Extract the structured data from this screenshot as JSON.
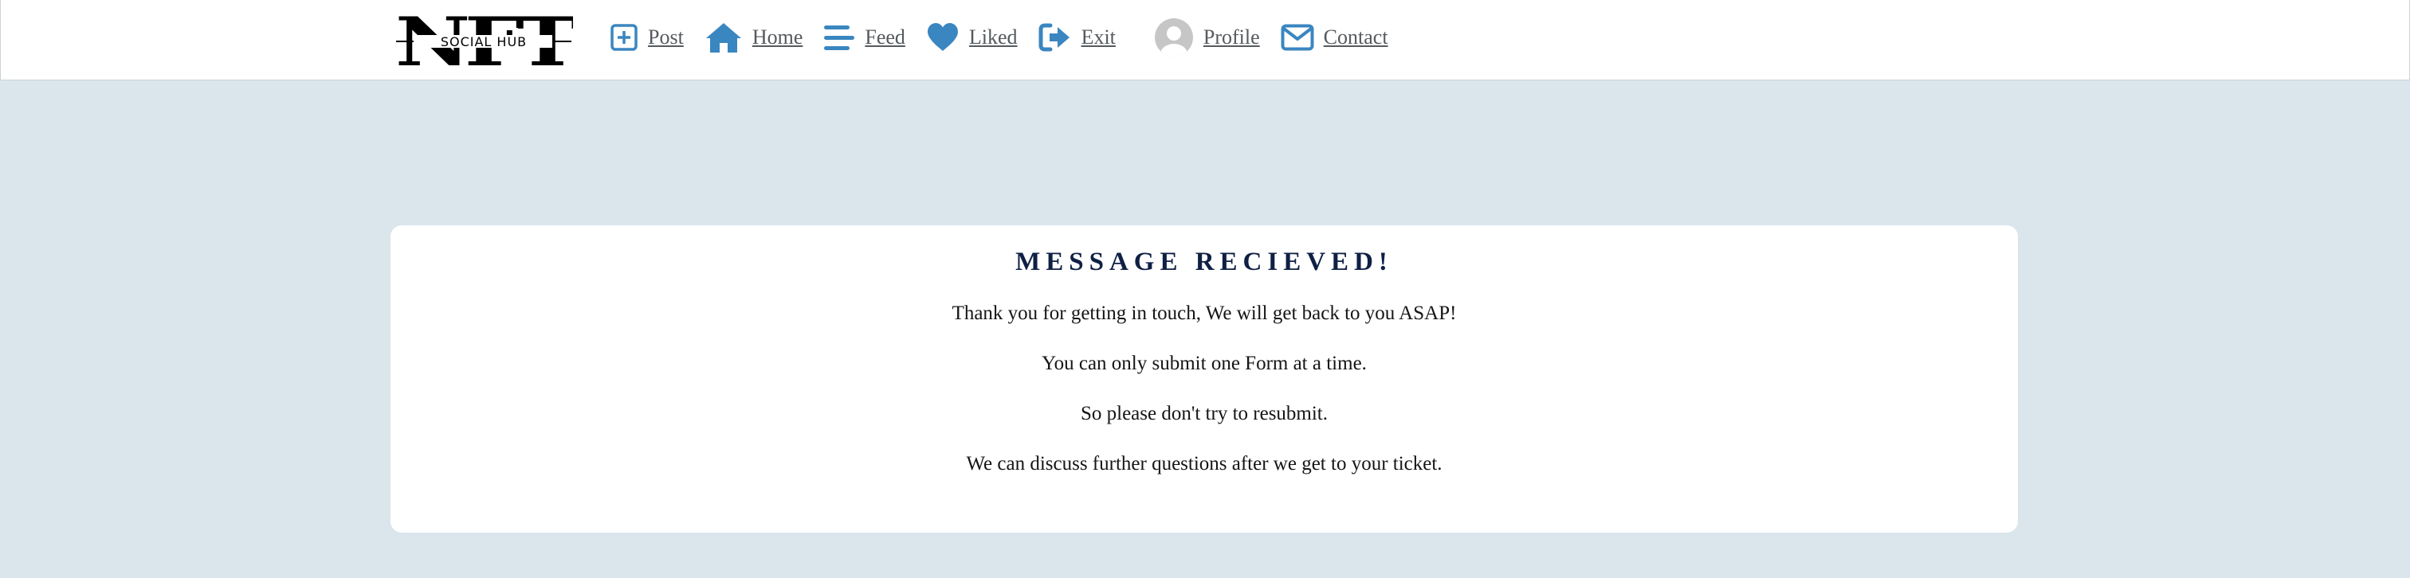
{
  "logo": {
    "top_text": "NFT",
    "sub_text": "SOCIAL HUB"
  },
  "nav": {
    "items": [
      {
        "label": "Post",
        "icon": "plus-square-icon"
      },
      {
        "label": "Home",
        "icon": "home-icon"
      },
      {
        "label": "Feed",
        "icon": "bars-icon"
      },
      {
        "label": "Liked",
        "icon": "heart-icon"
      },
      {
        "label": "Exit",
        "icon": "sign-out-icon"
      },
      {
        "label": "Profile",
        "icon": "avatar-icon"
      },
      {
        "label": "Contact",
        "icon": "envelope-icon"
      }
    ],
    "icon_color": "#3a86c0"
  },
  "card": {
    "title": "MESSAGE RECIEVED!",
    "lines": [
      "Thank you for getting in touch, We will get back to you ASAP!",
      "You can only submit one Form at a time.",
      "So please don't try to resubmit.",
      "We can discuss further questions after we get to your ticket."
    ]
  },
  "colors": {
    "background": "#dae5ec",
    "title": "#0f2044"
  }
}
